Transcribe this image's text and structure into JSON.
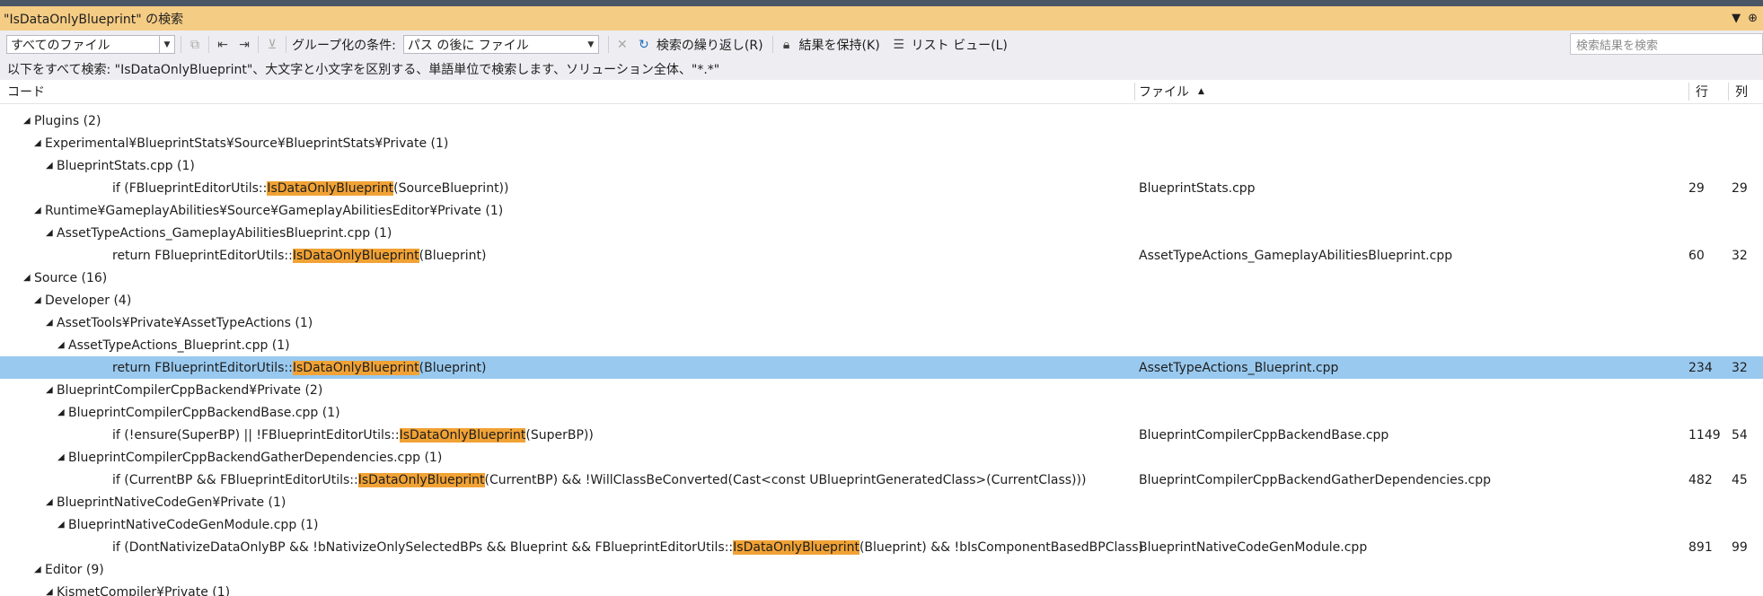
{
  "window": {
    "title": "\"IsDataOnlyBlueprint\" の検索",
    "dropdown_glyph": "▼",
    "pin_glyph": "⊕"
  },
  "toolbar": {
    "scope_value": "すべてのファイル",
    "group_label": "グループ化の条件:",
    "group_value": "パス の後に ファイル",
    "repeat_label": "検索の繰り返し(R)",
    "keep_label": "結果を保持(K)",
    "listview_label": "リスト ビュー(L)",
    "search_placeholder": "検索結果を検索"
  },
  "description": "以下をすべて検索: \"IsDataOnlyBlueprint\"、大文字と小文字を区別する、単語単位で検索します、ソリューション全体、\"*.*\"",
  "columns": {
    "code": "コード",
    "file": "ファイル",
    "line": "行",
    "col": "列"
  },
  "rows": [
    {
      "level": 1,
      "type": "group",
      "text": "Plugins (2)"
    },
    {
      "level": 2,
      "type": "group",
      "text": "Experimental¥BlueprintStats¥Source¥BlueprintStats¥Private (1)"
    },
    {
      "level": 3,
      "type": "group",
      "text": "BlueprintStats.cpp (1)"
    },
    {
      "level": 5,
      "type": "result",
      "pre": "if (FBlueprintEditorUtils::",
      "match": "IsDataOnlyBlueprint",
      "post": "(SourceBlueprint))",
      "file": "BlueprintStats.cpp",
      "line": "29",
      "col": "29"
    },
    {
      "level": 2,
      "type": "group",
      "text": "Runtime¥GameplayAbilities¥Source¥GameplayAbilitiesEditor¥Private (1)"
    },
    {
      "level": 3,
      "type": "group",
      "text": "AssetTypeActions_GameplayAbilitiesBlueprint.cpp (1)"
    },
    {
      "level": 5,
      "type": "result",
      "pre": "return FBlueprintEditorUtils::",
      "match": "IsDataOnlyBlueprint",
      "post": "(Blueprint)",
      "file": "AssetTypeActions_GameplayAbilitiesBlueprint.cpp",
      "line": "60",
      "col": "32"
    },
    {
      "level": 1,
      "type": "group",
      "text": "Source (16)"
    },
    {
      "level": 2,
      "type": "group",
      "text": "Developer (4)"
    },
    {
      "level": 3,
      "type": "group",
      "text": "AssetTools¥Private¥AssetTypeActions (1)"
    },
    {
      "level": 4,
      "type": "group",
      "text": "AssetTypeActions_Blueprint.cpp (1)"
    },
    {
      "level": 5,
      "type": "result",
      "selected": true,
      "pre": "return FBlueprintEditorUtils::",
      "match": "IsDataOnlyBlueprint",
      "post": "(Blueprint)",
      "file": "AssetTypeActions_Blueprint.cpp",
      "line": "234",
      "col": "32"
    },
    {
      "level": 3,
      "type": "group",
      "text": "BlueprintCompilerCppBackend¥Private (2)"
    },
    {
      "level": 4,
      "type": "group",
      "text": "BlueprintCompilerCppBackendBase.cpp (1)"
    },
    {
      "level": 5,
      "type": "result",
      "pre": "if (!ensure(SuperBP) || !FBlueprintEditorUtils::",
      "match": "IsDataOnlyBlueprint",
      "post": "(SuperBP))",
      "file": "BlueprintCompilerCppBackendBase.cpp",
      "line": "1149",
      "col": "54"
    },
    {
      "level": 4,
      "type": "group",
      "text": "BlueprintCompilerCppBackendGatherDependencies.cpp (1)"
    },
    {
      "level": 5,
      "type": "result",
      "pre": "if (CurrentBP && FBlueprintEditorUtils::",
      "match": "IsDataOnlyBlueprint",
      "post": "(CurrentBP) && !WillClassBeConverted(Cast<const UBlueprintGeneratedClass>(CurrentClass)))",
      "file": "BlueprintCompilerCppBackendGatherDependencies.cpp",
      "line": "482",
      "col": "45"
    },
    {
      "level": 3,
      "type": "group",
      "text": "BlueprintNativeCodeGen¥Private (1)"
    },
    {
      "level": 4,
      "type": "group",
      "text": "BlueprintNativeCodeGenModule.cpp (1)"
    },
    {
      "level": 5,
      "type": "result",
      "pre": "if (DontNativizeDataOnlyBP && !bNativizeOnlySelectedBPs && Blueprint && FBlueprintEditorUtils::",
      "match": "IsDataOnlyBlueprint",
      "post": "(Blueprint) && !bIsComponentBasedBPClass)",
      "file": "BlueprintNativeCodeGenModule.cpp",
      "line": "891",
      "col": "99"
    },
    {
      "level": 2,
      "type": "group",
      "text": "Editor (9)"
    },
    {
      "level": 3,
      "type": "group",
      "text": "KismetCompiler¥Private (1)"
    }
  ]
}
